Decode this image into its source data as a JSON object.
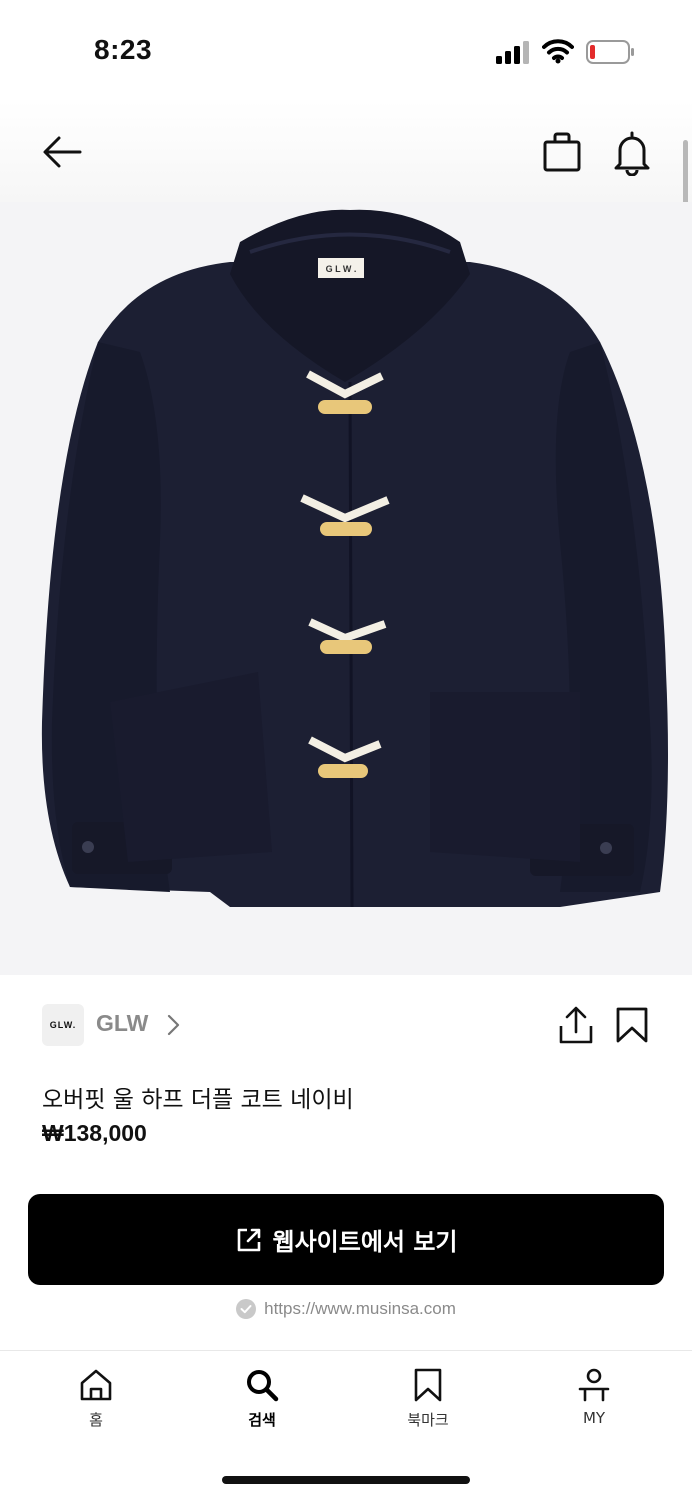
{
  "status_bar": {
    "time": "8:23"
  },
  "header": {
    "back_icon": "arrow-left-icon",
    "bag_icon": "shopping-bag-icon",
    "bell_icon": "bell-icon"
  },
  "product": {
    "image_icon": "coat-image",
    "brand_logo_text": "GLW.",
    "brand_name": "GLW",
    "title": "오버핏 울 하프 더플 코트 네이비",
    "price": "₩138,000",
    "image_colors": {
      "coat": "#1c1f33",
      "toggle": "#e8c77a",
      "rope": "#f3efe4"
    }
  },
  "cta": {
    "label": "웹사이트에서 보기",
    "icon": "external-link-icon",
    "background": "#000000"
  },
  "source": {
    "url": "https://www.musinsa.com",
    "icon": "check-circle-icon"
  },
  "tabs": [
    {
      "label": "홈",
      "icon": "home-icon",
      "active": false
    },
    {
      "label": "검색",
      "icon": "search-icon",
      "active": true
    },
    {
      "label": "북마크",
      "icon": "bookmark-icon",
      "active": false
    },
    {
      "label": "MY",
      "icon": "user-icon",
      "active": false
    }
  ]
}
